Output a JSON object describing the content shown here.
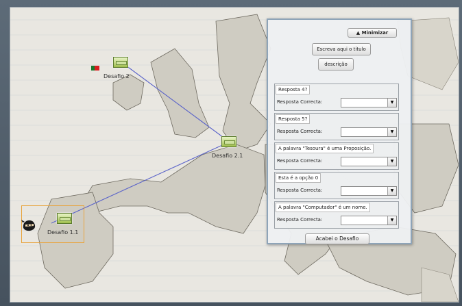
{
  "map": {
    "nodes": [
      {
        "label": "Desafio 2"
      },
      {
        "label": "Desafio 2.1"
      },
      {
        "label": "Desafio 1.1"
      }
    ]
  },
  "panel": {
    "minimize_label": "Minimizar",
    "title_placeholder": "Escreva aqui o título",
    "description_label": "descrição",
    "answer_label": "Resposta Correcta:",
    "questions": [
      {
        "text": "Resposta 4?"
      },
      {
        "text": "Resposta 5?"
      },
      {
        "text": "A palavra \"Tesoura\" é uma Proposição."
      },
      {
        "text": "Esta é a opção 0"
      },
      {
        "text": "A palavra \"Computador\" é um nome."
      }
    ],
    "finish_label": "Acabei o Desafio"
  },
  "colors": {
    "panel_border": "#8ea4b8",
    "line": "#5a63c9",
    "selection": "#e8a43d"
  }
}
